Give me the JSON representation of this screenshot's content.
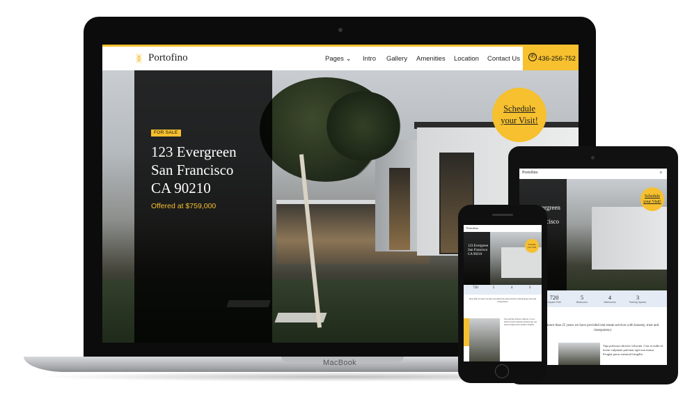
{
  "brand": {
    "name": "Portofino",
    "accent": "#f6c02e"
  },
  "nav": {
    "items": [
      "Pages",
      "Intro",
      "Gallery",
      "Amenities",
      "Location",
      "Contact Us"
    ],
    "phone": "436-256-752"
  },
  "hero": {
    "tag": "FOR SALE",
    "address_line1": "123 Evergreen",
    "address_line2": "San Francisco",
    "address_line3": "CA 90210",
    "offer": "Offered at $759,000",
    "schedule_line1": "Schedule",
    "schedule_line2": "your Visit!"
  },
  "device_label": "MacBook",
  "tablet": {
    "logo": "Portofino",
    "addr": "Evergreen San Francisco",
    "badge_line1": "Schedule",
    "badge_line2": "your Visit!",
    "stats": [
      {
        "value": "720",
        "label": "Square Feet"
      },
      {
        "value": "5",
        "label": "Bedrooms"
      },
      {
        "value": "4",
        "label": "Bathrooms"
      },
      {
        "value": "3",
        "label": "Parking Spaces"
      }
    ],
    "para": "more than 25 years we have provided real estate services with honesty, trust and transparency",
    "para2": "Tipa pulvinar ultricies vehicula. Cras et nulla id lorem vulputate pulvinar eget non massa Feugiat purus euismod fringilla."
  },
  "phone": {
    "logo": "Portofino",
    "addr": "123 Evergreen San Francisco CA 90210",
    "stats": [
      "720",
      "5",
      "4",
      "3"
    ]
  }
}
